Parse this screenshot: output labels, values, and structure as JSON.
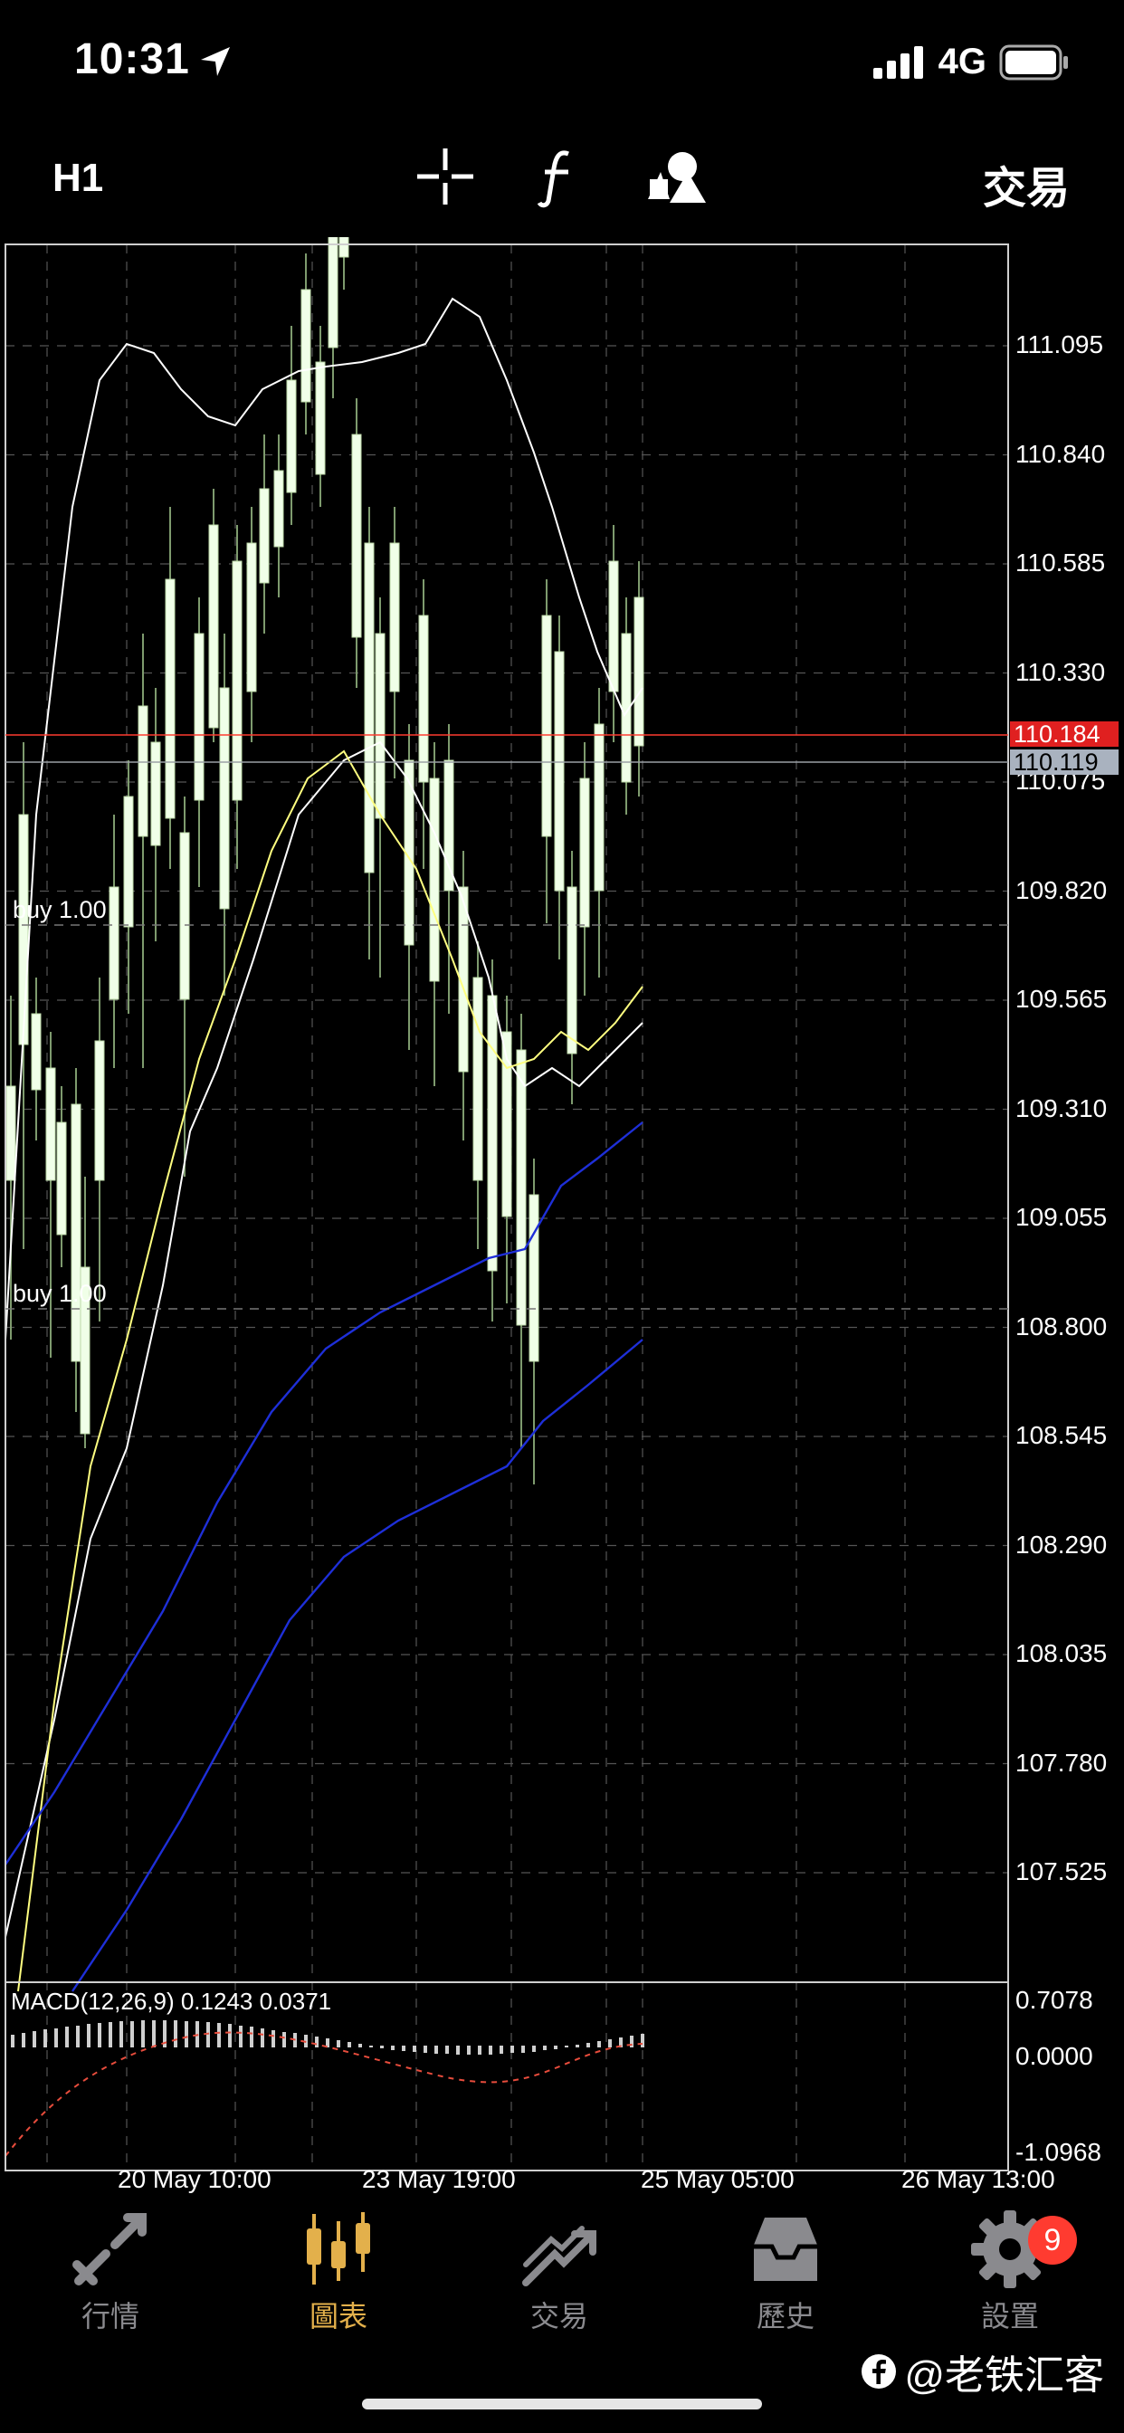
{
  "status_bar": {
    "time": "10:31",
    "network": "4G"
  },
  "toolbar": {
    "timeframe": "H1",
    "icons": [
      "crosshair-icon",
      "function-icon",
      "objects-icon"
    ],
    "trade_label": "交易"
  },
  "chart": {
    "price_axis": [
      "111.095",
      "110.840",
      "110.585",
      "110.330",
      "110.075",
      "109.820",
      "109.565",
      "109.310",
      "109.055",
      "108.800",
      "108.545",
      "108.290",
      "108.035",
      "107.780",
      "107.525"
    ],
    "bid_price": "110.184",
    "ask_price": "110.119",
    "order_labels": [
      "buy 1.00",
      "buy 1.00"
    ],
    "macd_label": "MACD(12,26,9) 0.1243 0.0371",
    "macd_axis": [
      "0.7078",
      "0.0000",
      "-1.0968"
    ],
    "time_axis": [
      "20 May 10:00",
      "23 May 19:00",
      "25 May 05:00",
      "26 May 13:00"
    ],
    "colors": {
      "bid_line": "#ff3b30",
      "ask_line": "#9aa0a6",
      "candle": "#f0ffe8",
      "ma_fast": "#ffff80",
      "ma_slow": "#1e2fd8"
    }
  },
  "tabs": [
    {
      "label": "行情",
      "icon": "quotes-icon",
      "active": false
    },
    {
      "label": "圖表",
      "icon": "chart-icon",
      "active": true
    },
    {
      "label": "交易",
      "icon": "trade-icon",
      "active": false
    },
    {
      "label": "歷史",
      "icon": "history-icon",
      "active": false
    },
    {
      "label": "設置",
      "icon": "settings-icon",
      "active": false
    }
  ],
  "settings_badge": "9",
  "watermark": "@老铁汇客"
}
